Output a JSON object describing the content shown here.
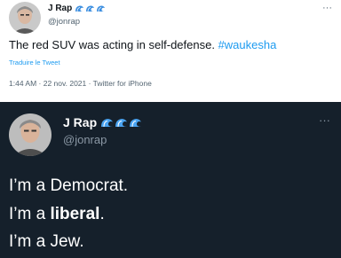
{
  "light_tweet": {
    "author_name": "J Rap",
    "author_handle": "@jonrap",
    "wave_emoji_count": 3,
    "text_plain": "The red SUV was acting in self-defense. ",
    "hashtag": "#waukesha",
    "translate_label": "Traduire le Tweet",
    "meta_time": "1:44 AM · 22 nov. 2021 · Twitter for iPhone",
    "more_label": "···"
  },
  "dark_tweet": {
    "author_name": "J Rap",
    "author_handle": "@jonrap",
    "wave_emoji_count": 3,
    "more_label": "···",
    "line1": "I’m a Democrat.",
    "line2_prefix": "I’m a ",
    "line2_bold": "liberal",
    "line2_suffix": ".",
    "line3": "I’m a Jew."
  },
  "colors": {
    "light_bg": "#ffffff",
    "dark_bg": "#15202b",
    "link_blue": "#1d9bf0",
    "secondary_light": "#536471",
    "secondary_dark": "#8b98a5"
  },
  "icons": [
    "water-wave-emoji-icon",
    "more-options-icon",
    "avatar-photo"
  ]
}
